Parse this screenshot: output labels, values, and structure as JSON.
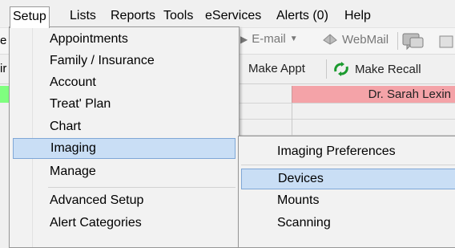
{
  "menubar": {
    "items": [
      "Setup",
      "Lists",
      "Reports",
      "Tools",
      "eServices",
      "Alerts (0)",
      "Help"
    ]
  },
  "toolbar": {
    "left_edge_row1": "e",
    "left_edge_row2": "ir",
    "email_label": "E-mail",
    "webmail_label": "WebMail",
    "make_appt_label": "Make Appt",
    "make_recall_label": "Make Recall"
  },
  "schedule": {
    "provider_header": "Dr. Sarah Lexin"
  },
  "setup_menu": {
    "items": [
      "Appointments",
      "Family / Insurance",
      "Account",
      "Treat' Plan",
      "Chart",
      "Imaging",
      "Manage",
      "Advanced Setup",
      "Alert Categories"
    ],
    "highlighted": "Imaging"
  },
  "imaging_submenu": {
    "items": [
      "Imaging Preferences",
      "Devices",
      "Mounts",
      "Scanning"
    ],
    "highlighted": "Devices"
  },
  "colors": {
    "highlight_bg": "#c9def5",
    "highlight_border": "#7fa7d6",
    "green_row": "#7fff7f",
    "pink_row": "#f4a3a8"
  }
}
